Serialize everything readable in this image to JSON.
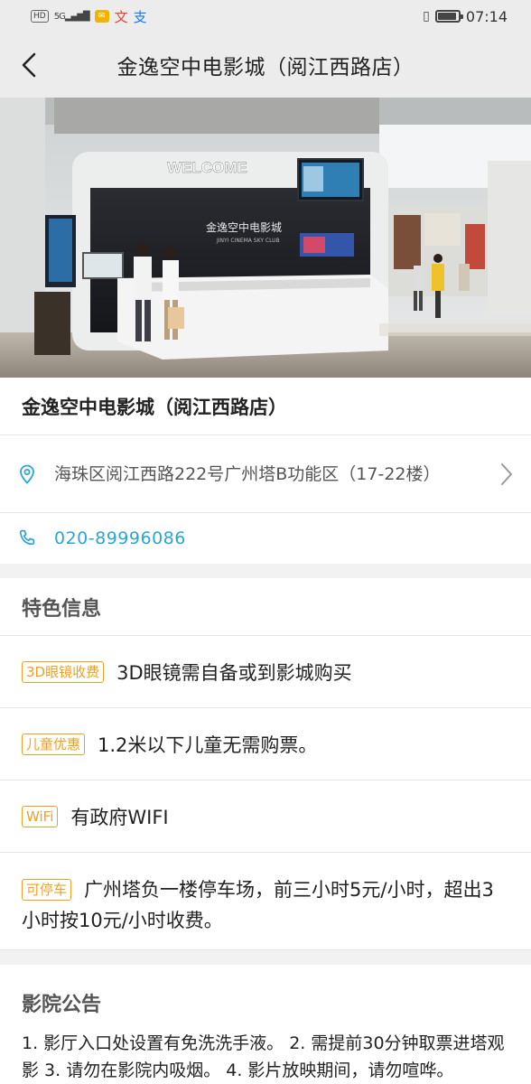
{
  "status_bar": {
    "hd": "HD",
    "signal": "5G",
    "mail_icon": "mail-icon",
    "app_icons": [
      "文",
      "支"
    ],
    "vibrate_icon": "vibrate-icon",
    "battery_level": 0.9,
    "time": "07:14"
  },
  "nav": {
    "back_icon": "chevron-left-icon",
    "title": "金逸空中电影城（阅江西路店）"
  },
  "photo": {
    "sign_text": "WELCOME",
    "logo_text": "金逸空中电影城",
    "logo_sub": "JINYI CINEMA SKY CLUB"
  },
  "cinema": {
    "name": "金逸空中电影城（阅江西路店）",
    "address": "海珠区阅江西路222号广州塔B功能区（17-22楼）",
    "phone": "020-89996086"
  },
  "features": {
    "title": "特色信息",
    "items": [
      {
        "tag": "3D眼镜收费",
        "text": "3D眼镜需自备或到影城购买"
      },
      {
        "tag": "儿童优惠",
        "text": "1.2米以下儿童无需购票。"
      },
      {
        "tag": "WiFi",
        "text": "有政府WIFI"
      },
      {
        "tag": "可停车",
        "text": "广州塔负一楼停车场，前三小时5元/小时，超出3小时按10元/小时收费。"
      }
    ]
  },
  "notice": {
    "title": "影院公告",
    "text": "1. 影厅入口处设置有免洗洗手液。 2. 需提前30分钟取票进塔观影 3. 请勿在影院内吸烟。 4. 影片放映期间，请勿喧哗。"
  },
  "colors": {
    "accent": "#2aa6d6",
    "tag": "#f0a020"
  }
}
